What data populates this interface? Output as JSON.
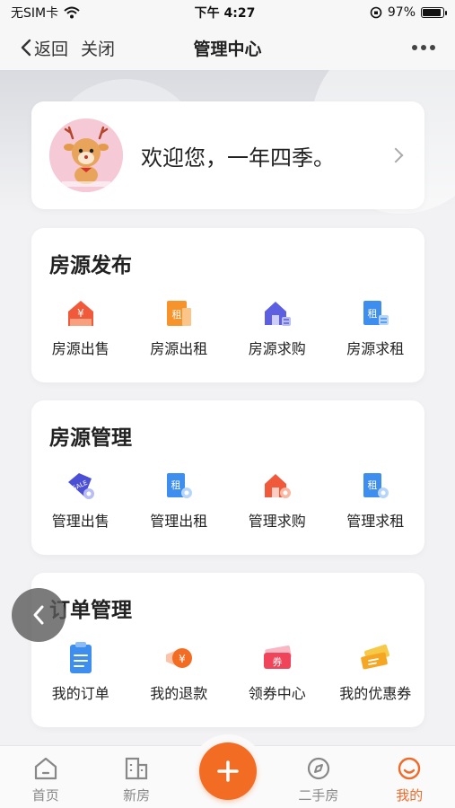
{
  "status_bar": {
    "carrier": "无SIM卡",
    "time": "下午 4:27",
    "battery": "97%"
  },
  "nav": {
    "back_label": "返回",
    "close_label": "关闭",
    "title": "管理中心"
  },
  "profile": {
    "greeting": "欢迎您，一年四季。"
  },
  "publish": {
    "title": "房源发布",
    "items": [
      {
        "label": "房源出售",
        "icon": "house-yen-icon"
      },
      {
        "label": "房源出租",
        "icon": "rent-building-icon"
      },
      {
        "label": "房源求购",
        "icon": "house-search-icon"
      },
      {
        "label": "房源求租",
        "icon": "rent-search-icon"
      }
    ]
  },
  "manage": {
    "title": "房源管理",
    "items": [
      {
        "label": "管理出售",
        "icon": "sale-tag-icon"
      },
      {
        "label": "管理出租",
        "icon": "rent-manage-icon"
      },
      {
        "label": "管理求购",
        "icon": "house-manage-icon"
      },
      {
        "label": "管理求租",
        "icon": "rent-request-manage-icon"
      }
    ]
  },
  "orders": {
    "title": "订单管理",
    "items": [
      {
        "label": "我的订单",
        "icon": "clipboard-icon"
      },
      {
        "label": "我的退款",
        "icon": "refund-coin-icon"
      },
      {
        "label": "领券中心",
        "icon": "coupon-center-icon"
      },
      {
        "label": "我的优惠券",
        "icon": "my-coupons-icon"
      }
    ]
  },
  "tabs": [
    {
      "label": "首页",
      "icon": "home-icon"
    },
    {
      "label": "新房",
      "icon": "building-icon"
    },
    {
      "label": "",
      "icon": "plus-icon"
    },
    {
      "label": "二手房",
      "icon": "compass-icon"
    },
    {
      "label": "我的",
      "icon": "smiley-icon"
    }
  ],
  "colors": {
    "accent": "#f36c23",
    "active_tab": "#f06a2a"
  }
}
